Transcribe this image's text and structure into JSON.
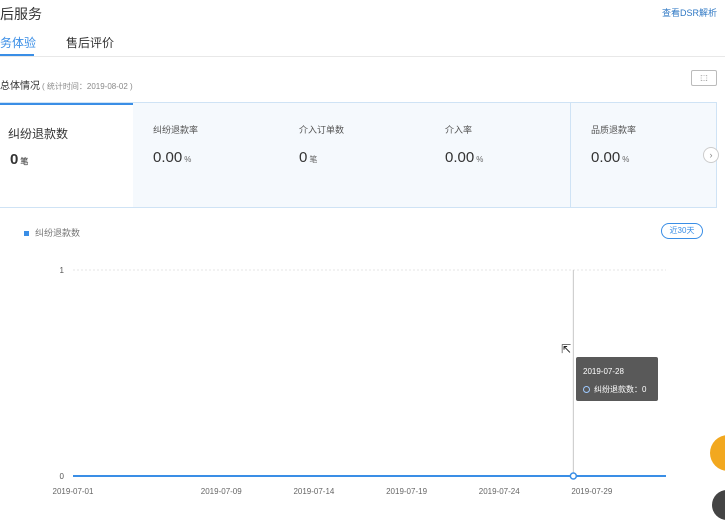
{
  "header": {
    "title": "后服务",
    "dsr_link": "查看DSR解析"
  },
  "tabs": [
    {
      "label": "务体验",
      "active": true
    },
    {
      "label": "售后评价",
      "active": false
    }
  ],
  "overview": {
    "title": "总体情况",
    "stat_time": "( 统计时间：2019-08-02 )",
    "export_label": "⬚"
  },
  "metrics": [
    {
      "label": "纠纷退款数",
      "value": "0",
      "unit": "笔"
    },
    {
      "label": "纠纷退款率",
      "value": "0.00",
      "unit": "%"
    },
    {
      "label": "介入订单数",
      "value": "0",
      "unit": "笔"
    },
    {
      "label": "介入率",
      "value": "0.00",
      "unit": "%"
    },
    {
      "label": "品质退款率",
      "value": "0.00",
      "unit": "%"
    }
  ],
  "chart_controls": {
    "range_label": "近30天",
    "next_arrow": "›"
  },
  "colors": {
    "accent": "#3a8ee6",
    "line": "#3a8ee6",
    "float_button": "#f2a81f"
  },
  "tooltip": {
    "date": "2019-07-28",
    "row": "纠纷退款数：0"
  },
  "chart_data": {
    "type": "line",
    "legend": [
      "纠纷退款数"
    ],
    "ylim": [
      0,
      1
    ],
    "y_ticks": [
      "0",
      "1"
    ],
    "x_ticks": [
      "2019-07-01",
      "2019-07-09",
      "2019-07-14",
      "2019-07-19",
      "2019-07-24",
      "2019-07-29"
    ],
    "x_start": "2019-07-01",
    "x_end": "2019-08-02",
    "series": [
      {
        "name": "纠纷退款数",
        "value_all_days": 0
      }
    ],
    "highlight_date": "2019-07-28"
  }
}
